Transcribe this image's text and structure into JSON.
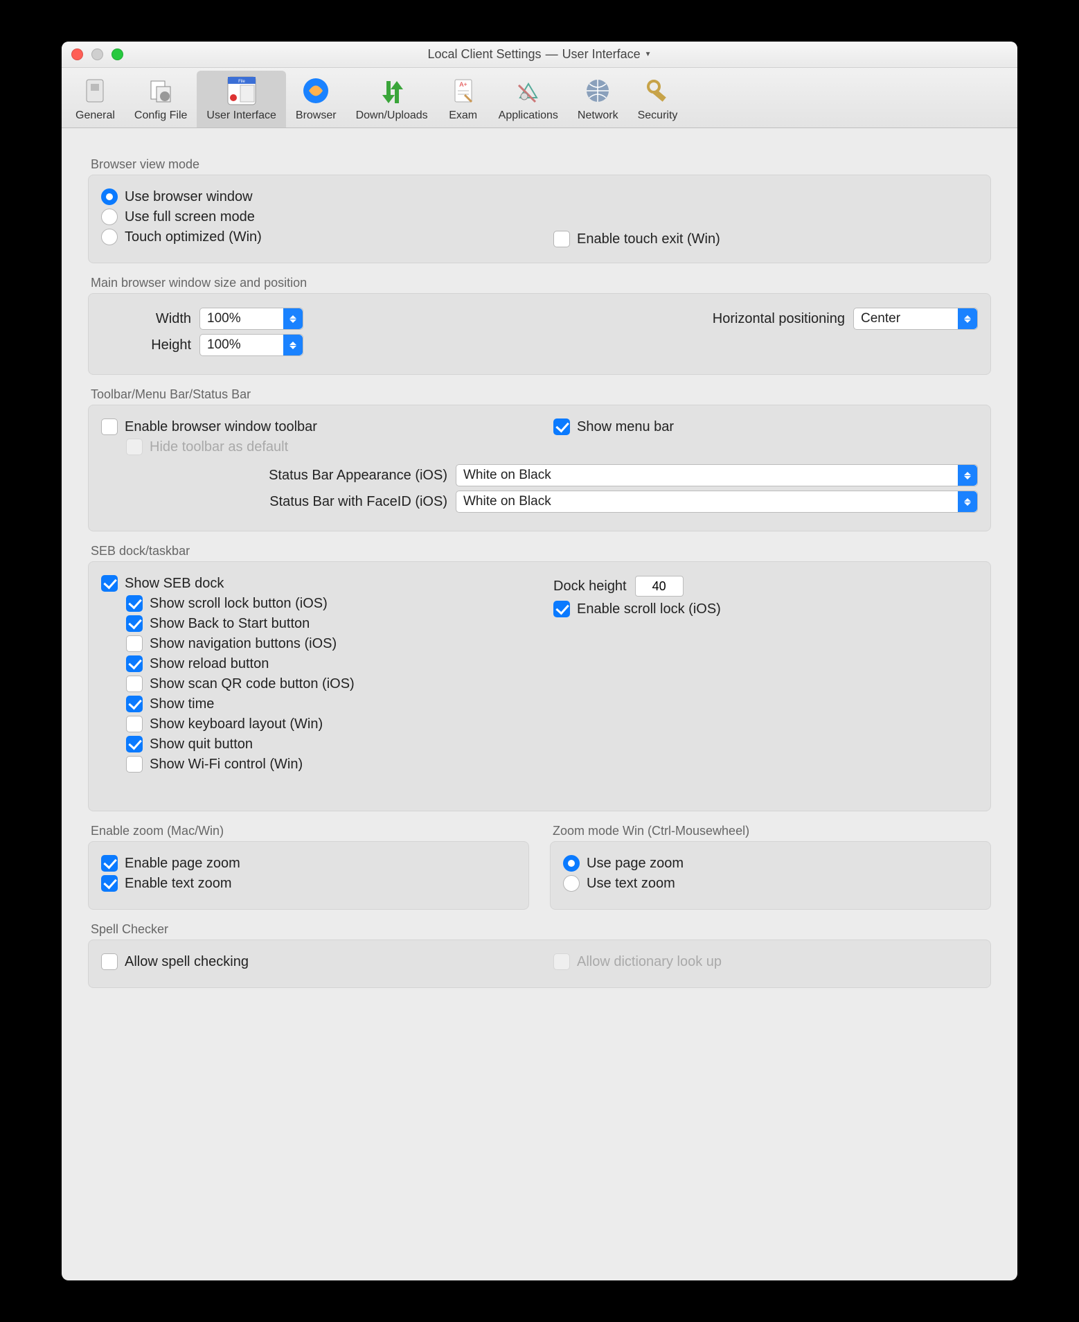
{
  "window": {
    "title_left": "Local Client Settings",
    "title_sep": "—",
    "title_right": "User Interface"
  },
  "toolbar": {
    "items": [
      {
        "label": "General"
      },
      {
        "label": "Config File"
      },
      {
        "label": "User Interface"
      },
      {
        "label": "Browser"
      },
      {
        "label": "Down/Uploads"
      },
      {
        "label": "Exam"
      },
      {
        "label": "Applications"
      },
      {
        "label": "Network"
      },
      {
        "label": "Security"
      }
    ]
  },
  "sections": {
    "viewmode": {
      "title": "Browser view mode",
      "opt1": "Use browser window",
      "opt2": "Use full screen mode",
      "opt3": "Touch optimized (Win)",
      "touch_exit": "Enable touch exit (Win)"
    },
    "size": {
      "title": "Main browser window size and position",
      "width_label": "Width",
      "width_value": "100%",
      "height_label": "Height",
      "height_value": "100%",
      "hpos_label": "Horizontal positioning",
      "hpos_value": "Center"
    },
    "bars": {
      "title": "Toolbar/Menu Bar/Status Bar",
      "enable_toolbar": "Enable browser window toolbar",
      "hide_toolbar": "Hide toolbar as default",
      "show_menu": "Show menu bar",
      "status_ios_label": "Status Bar Appearance (iOS)",
      "status_ios_value": "White on Black",
      "status_faceid_label": "Status Bar with FaceID (iOS)",
      "status_faceid_value": "White on Black"
    },
    "dock": {
      "title": "SEB dock/taskbar",
      "show_dock": "Show SEB dock",
      "items": [
        "Show scroll lock button (iOS)",
        "Show Back to Start button",
        "Show navigation buttons (iOS)",
        "Show reload button",
        "Show scan QR code button (iOS)",
        "Show time",
        "Show keyboard layout (Win)",
        "Show quit button",
        "Show Wi-Fi control (Win)"
      ],
      "item_states": [
        true,
        true,
        false,
        true,
        false,
        true,
        false,
        true,
        false
      ],
      "dock_height_label": "Dock height",
      "dock_height_value": "40",
      "enable_scroll_lock": "Enable scroll lock (iOS)"
    },
    "zoom": {
      "title": "Enable zoom (Mac/Win)",
      "page": "Enable page zoom",
      "text": "Enable text zoom"
    },
    "zoommode": {
      "title": "Zoom mode Win (Ctrl-Mousewheel)",
      "page": "Use page zoom",
      "text": "Use text zoom"
    },
    "spell": {
      "title": "Spell Checker",
      "allow": "Allow spell checking",
      "dict": "Allow dictionary look up"
    }
  }
}
